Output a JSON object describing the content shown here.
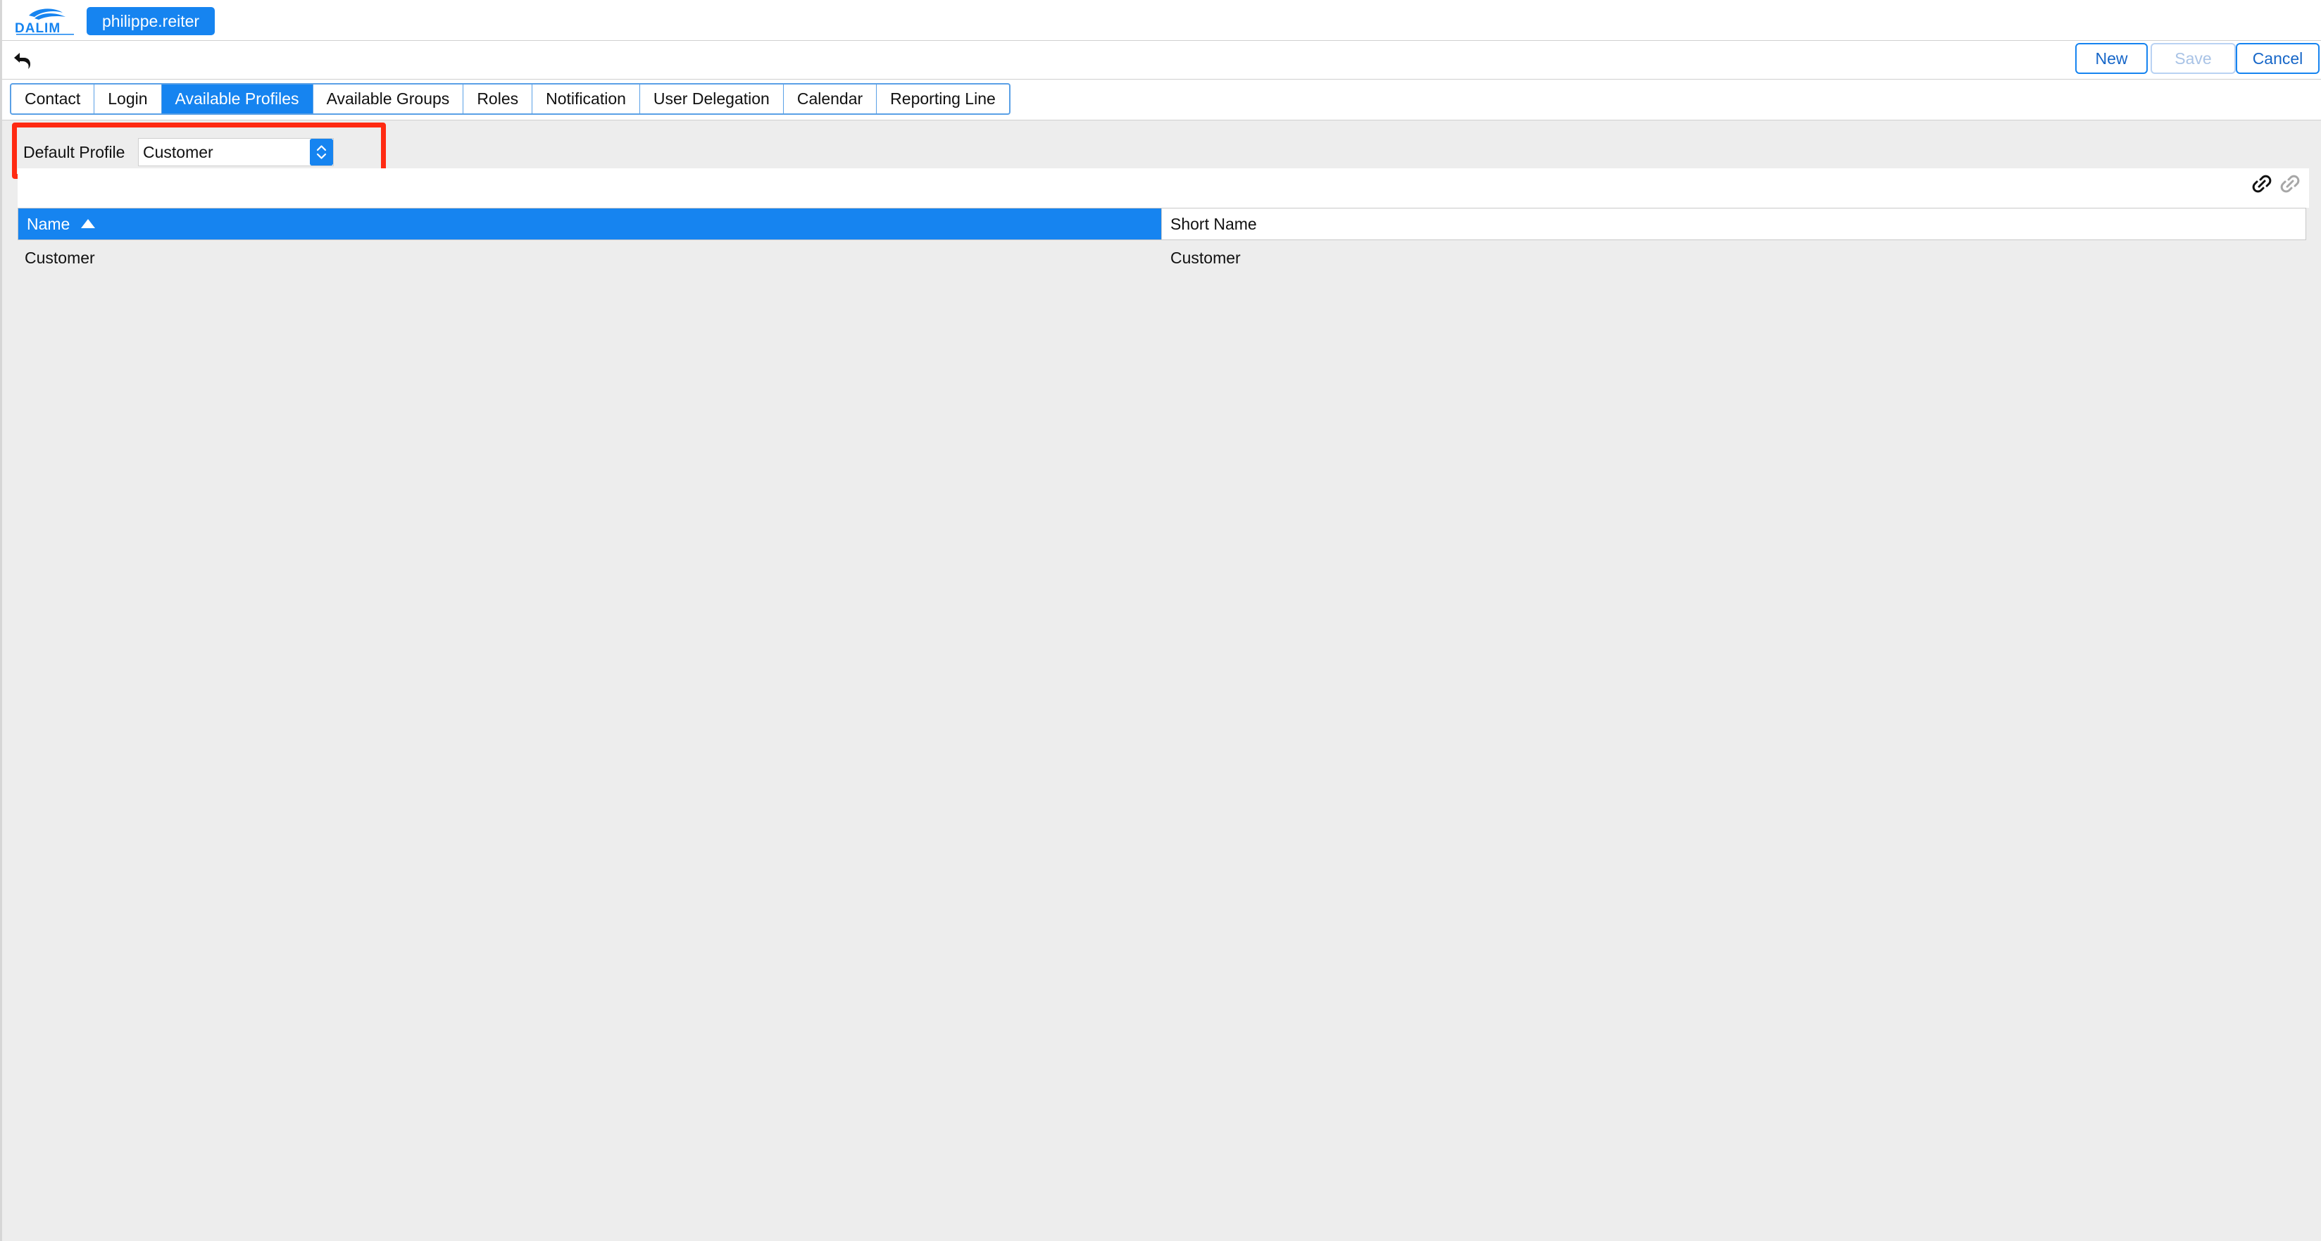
{
  "header": {
    "logo": {
      "icon": "dalim-logo-icon",
      "brand_color": "#1684f0"
    },
    "user": "philippe.reiter"
  },
  "toolbar": {
    "back_icon": "back-arrow-icon",
    "new_label": "New",
    "save_label": "Save",
    "cancel_label": "Cancel"
  },
  "tabs": [
    {
      "label": "Contact",
      "active": false
    },
    {
      "label": "Login",
      "active": false
    },
    {
      "label": "Available Profiles",
      "active": true
    },
    {
      "label": "Available Groups",
      "active": false
    },
    {
      "label": "Roles",
      "active": false
    },
    {
      "label": "Notification",
      "active": false
    },
    {
      "label": "User Delegation",
      "active": false
    },
    {
      "label": "Calendar",
      "active": false
    },
    {
      "label": "Reporting Line",
      "active": false
    }
  ],
  "default_profile": {
    "label": "Default Profile",
    "selected": "Customer",
    "highlight_color": "#ff2a12"
  },
  "grid": {
    "tools": [
      "link-icon",
      "unlink-icon"
    ],
    "columns": [
      {
        "label": "Name",
        "sort": "ascending"
      },
      {
        "label": "Short Name"
      }
    ],
    "rows": [
      {
        "name": "Customer",
        "short_name": "Customer"
      }
    ]
  },
  "colors": {
    "accent": "#1684f0",
    "background": "#ededed",
    "disabled": "#a9c3e6"
  }
}
